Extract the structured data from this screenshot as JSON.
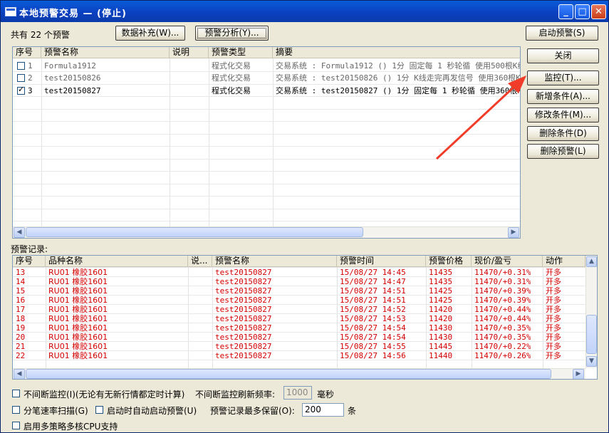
{
  "window": {
    "title": "本地预警交易 — (停止)"
  },
  "top": {
    "count_label": "共有 22 个预警",
    "data_fill_button": "数据补充(W)...",
    "analysis_button": "预警分析(Y)...",
    "start_button": "启动预警(S)"
  },
  "side_buttons": {
    "close": "关闭",
    "monitor": "监控(T)...",
    "add_condition": "新增条件(A)...",
    "edit_condition": "修改条件(M)...",
    "delete_condition": "删除条件(D)",
    "delete_alert": "删除预警(L)"
  },
  "alerts_table": {
    "headers": [
      "序号",
      "预警名称",
      "说明",
      "预警类型",
      "摘要"
    ],
    "rows": [
      {
        "index": "1",
        "checked": false,
        "name": "Formula1912",
        "desc": "",
        "type": "程式化交易",
        "summary": "交易系统 : Formula1912 () 1分 固定每 1 秒轮循 使用500根K线",
        "muted": true
      },
      {
        "index": "2",
        "checked": false,
        "name": "test20150826",
        "desc": "",
        "type": "程式化交易",
        "summary": "交易系统 : test20150826 () 1分 K线走完再发信号 使用360根K",
        "muted": true
      },
      {
        "index": "3",
        "checked": true,
        "name": "test20150827",
        "desc": "",
        "type": "程式化交易",
        "summary": "交易系统 : test20150827 () 1分 固定每 1 秒轮循 使用360根K",
        "muted": false
      }
    ]
  },
  "records_label": "预警记录:",
  "records_table": {
    "headers": [
      "序号",
      "品种名称",
      "说...",
      "预警名称",
      "预警时间",
      "预警价格",
      "现价/盈亏",
      "动作"
    ],
    "rows": [
      {
        "index": "13",
        "symbol": "RU01 橡胶1601",
        "note": "",
        "name": "test20150827",
        "time": "15/08/27 14:45",
        "price": "11435",
        "now": "11470/+0.31%",
        "action": "开多"
      },
      {
        "index": "14",
        "symbol": "RU01 橡胶1601",
        "note": "",
        "name": "test20150827",
        "time": "15/08/27 14:47",
        "price": "11435",
        "now": "11470/+0.31%",
        "action": "开多"
      },
      {
        "index": "15",
        "symbol": "RU01 橡胶1601",
        "note": "",
        "name": "test20150827",
        "time": "15/08/27 14:51",
        "price": "11425",
        "now": "11470/+0.39%",
        "action": "开多"
      },
      {
        "index": "16",
        "symbol": "RU01 橡胶1601",
        "note": "",
        "name": "test20150827",
        "time": "15/08/27 14:51",
        "price": "11425",
        "now": "11470/+0.39%",
        "action": "开多"
      },
      {
        "index": "17",
        "symbol": "RU01 橡胶1601",
        "note": "",
        "name": "test20150827",
        "time": "15/08/27 14:52",
        "price": "11420",
        "now": "11470/+0.44%",
        "action": "开多"
      },
      {
        "index": "18",
        "symbol": "RU01 橡胶1601",
        "note": "",
        "name": "test20150827",
        "time": "15/08/27 14:53",
        "price": "11420",
        "now": "11470/+0.44%",
        "action": "开多"
      },
      {
        "index": "19",
        "symbol": "RU01 橡胶1601",
        "note": "",
        "name": "test20150827",
        "time": "15/08/27 14:54",
        "price": "11430",
        "now": "11470/+0.35%",
        "action": "开多"
      },
      {
        "index": "20",
        "symbol": "RU01 橡胶1601",
        "note": "",
        "name": "test20150827",
        "time": "15/08/27 14:54",
        "price": "11430",
        "now": "11470/+0.35%",
        "action": "开多"
      },
      {
        "index": "21",
        "symbol": "RU01 橡胶1601",
        "note": "",
        "name": "test20150827",
        "time": "15/08/27 14:55",
        "price": "11445",
        "now": "11470/+0.22%",
        "action": "开多"
      },
      {
        "index": "22",
        "symbol": "RU01 橡胶1601",
        "note": "",
        "name": "test20150827",
        "time": "15/08/27 14:56",
        "price": "11440",
        "now": "11470/+0.26%",
        "action": "开多"
      }
    ]
  },
  "options": {
    "continuous_monitor": "不间断监控(I)(无论有无新行情都定时计算)",
    "refresh_rate_label": "不间断监控刷新频率:",
    "refresh_rate_value": "1000",
    "refresh_rate_unit": "毫秒",
    "tick_scan": "分笔速率扫描(G)",
    "auto_start": "启动时自动启动预警(U)",
    "max_records_label": "预警记录最多保留(O):",
    "max_records_value": "200",
    "max_records_unit": "条",
    "multi_core": "启用多策略多核CPU支持"
  },
  "colors": {
    "record_text": "#d40000",
    "annotation_arrow": "#f03c28"
  }
}
